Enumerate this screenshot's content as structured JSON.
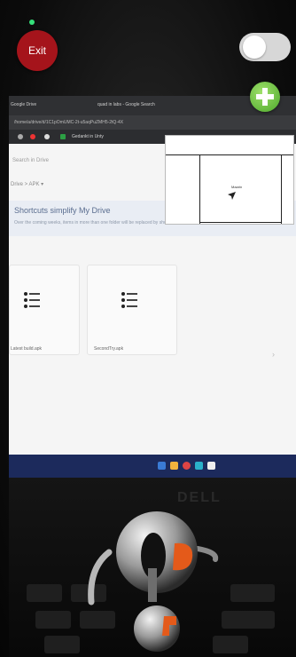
{
  "exit_button": {
    "label": "Exit"
  },
  "toggle": {
    "state": "off"
  },
  "add_button": {
    "icon": "plus-icon"
  },
  "captured_screen": {
    "tabs": [
      "Google Drive",
      "quad in labs - Google Search"
    ],
    "url": "/home/a/drive/d/1C1pOmUMC-2t-u5aqPuZMH5-2tQ-4X",
    "bookmark": "Gedankt in Unty",
    "search_hint": "Search in Drive",
    "breadcrumb": "Drive  >  APK  ▾",
    "banner_title": "Shortcuts simplify My Drive",
    "banner_text": "Over the coming weeks, items in more than one folder will be replaced by shortcuts. Access to files will not change.",
    "files": [
      "Latest build.apk",
      "SecondTry.apk"
    ],
    "room_label": "Maarin"
  },
  "laptop_brand": "DELL"
}
